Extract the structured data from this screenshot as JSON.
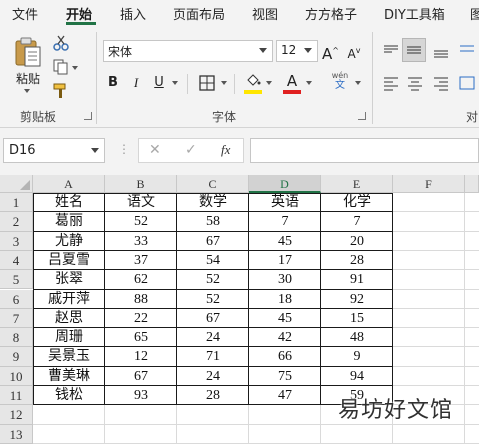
{
  "ribbon_tabs": [
    {
      "label": "文件",
      "active": false
    },
    {
      "label": "开始",
      "active": true
    },
    {
      "label": "插入",
      "active": false
    },
    {
      "label": "页面布局",
      "active": false
    },
    {
      "label": "视图",
      "active": false
    },
    {
      "label": "方方格子",
      "active": false
    },
    {
      "label": "DIY工具箱",
      "active": false
    },
    {
      "label": "图",
      "active": false
    }
  ],
  "clipboard": {
    "paste_label": "粘贴",
    "group_label": "剪贴板",
    "icons": [
      "paste-icon",
      "cut-icon",
      "copy-icon",
      "format-painter-icon"
    ]
  },
  "font_group": {
    "font_name": "宋体",
    "font_size": "12",
    "grow_label": "A",
    "shrink_label": "A",
    "bold": "B",
    "italic": "I",
    "underline": "U",
    "font_color_letter": "A",
    "fill_color": "#ffe600",
    "font_color": "#e02020",
    "phonetic_top": "wén",
    "phonetic_bottom": "文",
    "group_label": "字体"
  },
  "alignment_group": {
    "label_partial": "对",
    "icons": [
      "align-top-icon",
      "align-middle-icon",
      "align-bottom-icon",
      "align-left-icon",
      "align-center-icon",
      "align-right-icon"
    ]
  },
  "formula_bar": {
    "name_box": "D16",
    "cancel_icon": "✕",
    "enter_icon": "✓",
    "fx_label": "fx",
    "formula": ""
  },
  "sheet": {
    "selected_column": "D",
    "columns": [
      "A",
      "B",
      "C",
      "D",
      "E",
      "F"
    ],
    "rows": [
      "1",
      "2",
      "3",
      "4",
      "5",
      "6",
      "7",
      "8",
      "9",
      "10",
      "11",
      "12",
      "13"
    ],
    "table": [
      [
        "姓名",
        "语文",
        "数学",
        "英语",
        "化学"
      ],
      [
        "葛丽",
        "52",
        "58",
        "7",
        "7"
      ],
      [
        "尤静",
        "33",
        "67",
        "45",
        "20"
      ],
      [
        "吕夏雪",
        "37",
        "54",
        "17",
        "28"
      ],
      [
        "张翠",
        "62",
        "52",
        "30",
        "91"
      ],
      [
        "戚开萍",
        "88",
        "52",
        "18",
        "92"
      ],
      [
        "赵思",
        "22",
        "67",
        "45",
        "15"
      ],
      [
        "周珊",
        "65",
        "24",
        "42",
        "48"
      ],
      [
        "吴景玉",
        "12",
        "71",
        "66",
        "9"
      ],
      [
        "曹美琳",
        "67",
        "24",
        "75",
        "94"
      ],
      [
        "钱松",
        "93",
        "28",
        "47",
        "59"
      ]
    ]
  },
  "watermark": "易坊好文馆"
}
